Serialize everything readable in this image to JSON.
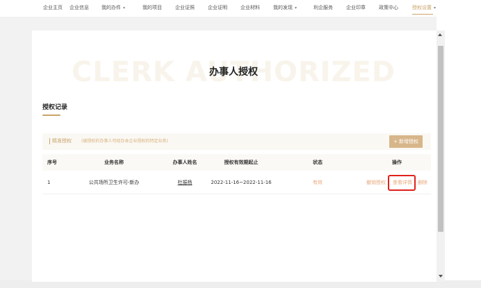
{
  "nav": {
    "items": [
      {
        "label": "企业主页",
        "caret": ""
      },
      {
        "label": "企业信息",
        "caret": ""
      },
      {
        "label": "我的办件",
        "caret": "▾"
      },
      {
        "label": "我的项目",
        "caret": ""
      },
      {
        "label": "企业证照",
        "caret": ""
      },
      {
        "label": "企业证明",
        "caret": ""
      },
      {
        "label": "企业材料",
        "caret": ""
      },
      {
        "label": "我的发现",
        "caret": "▾"
      },
      {
        "label": "利企服务",
        "caret": ""
      },
      {
        "label": "企业印章",
        "caret": ""
      },
      {
        "label": "政策中心",
        "caret": ""
      },
      {
        "label": "授权设置",
        "caret": "▾"
      }
    ],
    "active_index": 11
  },
  "page": {
    "watermark": "CLERK AUTHORIZED",
    "title": "办事人授权"
  },
  "section": {
    "title": "授权记录"
  },
  "filter": {
    "label": "精准授权",
    "note": "(被授权的办事人可经办本企业授权的特定业务)",
    "add_button": "+ 新增授权"
  },
  "table": {
    "columns": [
      "序号",
      "业务名称",
      "办事人姓名",
      "授权有效期起止",
      "状态",
      "操作"
    ],
    "rows": [
      {
        "index": "1",
        "business": "公共场所卫生许可-新办",
        "person": "杜振杨",
        "period": "2022-11-16~2022-11-16",
        "status": "有效",
        "actions": {
          "revoke": "撤销授权",
          "detail": "查看详情",
          "delete": "删除",
          "sep": "|"
        }
      }
    ]
  },
  "colors": {
    "accent": "#c9a46a",
    "link": "#e8a87c",
    "highlight": "#e0201a"
  }
}
